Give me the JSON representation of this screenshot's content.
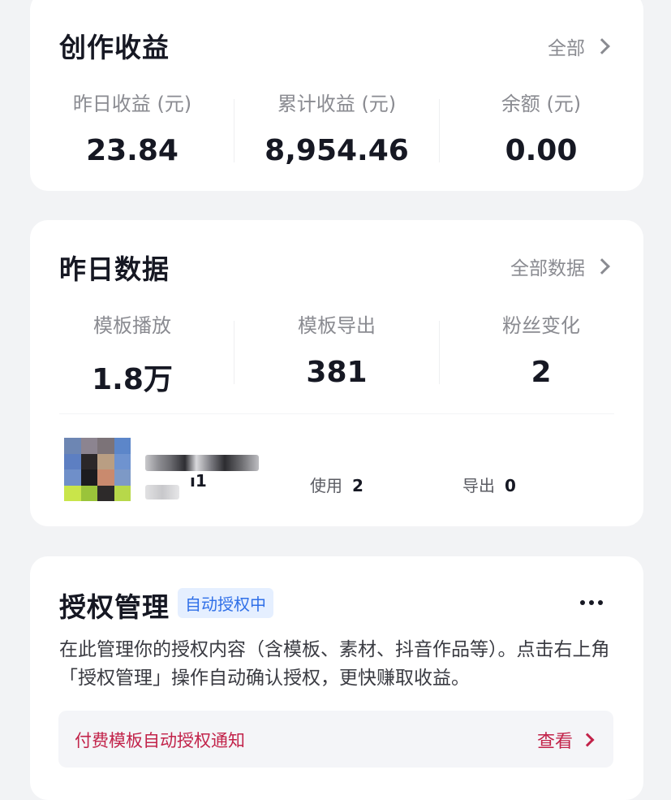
{
  "earnings": {
    "title": "创作收益",
    "all_link": "全部",
    "stats": [
      {
        "label": "昨日收益 (元)",
        "value": "23.84"
      },
      {
        "label": "累计收益 (元)",
        "value": "8,954.46"
      },
      {
        "label": "余额 (元)",
        "value": "0.00"
      }
    ]
  },
  "yesterday": {
    "title": "昨日数据",
    "all_link": "全部数据",
    "stats": [
      {
        "label": "模板播放",
        "value": "1.8万"
      },
      {
        "label": "模板导出",
        "value": "381"
      },
      {
        "label": "粉丝变化",
        "value": "2"
      }
    ],
    "template_item": {
      "name_tail": "ı1",
      "use_label": "使用",
      "use_count": "2",
      "export_label": "导出",
      "export_count": "0"
    }
  },
  "auth": {
    "title": "授权管理",
    "badge": "自动授权中",
    "description": "在此管理你的授权内容（含模板、素材、抖音作品等）。点击右上角「授权管理」操作自动确认授权，更快赚取收益。",
    "notice_text": "付费模板自动授权通知",
    "notice_link": "查看"
  }
}
